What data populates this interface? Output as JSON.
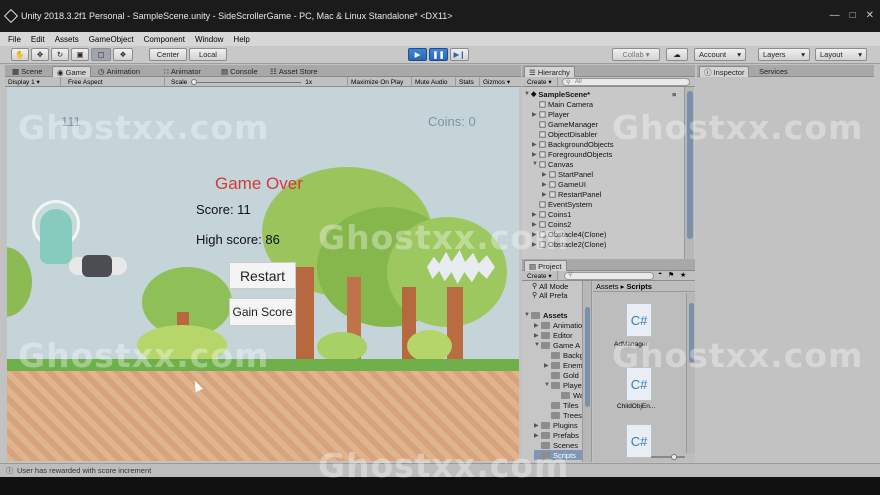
{
  "titlebar": {
    "title": "Unity 2018.3.2f1 Personal - SampleScene.unity - SideScrollerGame - PC, Mac & Linux Standalone* <DX11>"
  },
  "menu": [
    "File",
    "Edit",
    "Assets",
    "GameObject",
    "Component",
    "Window",
    "Help"
  ],
  "toolbar": {
    "center": "Center",
    "local": "Local",
    "collab": "Collab",
    "account": "Account",
    "layers": "Layers",
    "layout": "Layout"
  },
  "scene_tabs": [
    "Scene",
    "Game",
    "Animation",
    "Animator",
    "Console",
    "Asset Store"
  ],
  "game_bar": {
    "display": "Display 1",
    "aspect": "Free Aspect",
    "scale": "Scale",
    "scale_value": "1x",
    "maximize": "Maximize On Play",
    "mute": "Mute Audio",
    "stats": "Stats",
    "gizmos": "Gizmos"
  },
  "game": {
    "top_left": "111",
    "coins": "Coins: 0",
    "game_over": "Game Over",
    "score": "Score: 11",
    "high_score": "High score: 86",
    "restart": "Restart",
    "gain_score": "Gain Score"
  },
  "hierarchy": {
    "tab": "Hierarchy",
    "create": "Create",
    "search": "All",
    "scene": "SampleScene*",
    "items": [
      "Main Camera",
      "Player",
      "GameManager",
      "ObjectDisabler",
      "BackgroundObjects",
      "ForegroundObjects",
      "Canvas",
      "StartPanel",
      "GameUI",
      "RestartPanel",
      "EventSystem",
      "Coins1",
      "Coins2",
      "Obstacle4(Clone)",
      "Obstacle2(Clone)"
    ]
  },
  "inspector": {
    "tab": "Inspector",
    "services": "Services"
  },
  "project": {
    "tab": "Project",
    "create": "Create",
    "favorites": [
      "All Mode",
      "All Prefa"
    ],
    "assets_root": "Assets",
    "tree": [
      "Animatio",
      "Editor",
      "Game A",
      "Backg",
      "Enem",
      "Gold",
      "Player",
      "Wa",
      "Tiles",
      "Trees",
      "Plugins",
      "Prefabs",
      "Scenes",
      "Scripts"
    ],
    "breadcrumb": [
      "Assets",
      "Scripts"
    ],
    "files": [
      "AdManager",
      "ChildObjEn...",
      ""
    ],
    "file_icon_label": "C#"
  },
  "status": {
    "message": "User has rewarded with score increment"
  },
  "watermark": "Ghostxx.com"
}
